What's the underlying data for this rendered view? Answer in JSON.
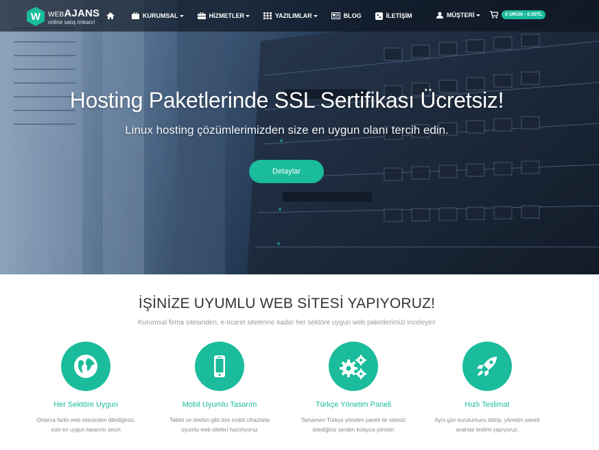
{
  "brand": {
    "logo_letter": "W",
    "name_prefix": "WEB",
    "name_main": "AJANS",
    "tagline": "online satış imkanı!"
  },
  "nav": {
    "home_icon": "home-icon",
    "items": [
      {
        "label": "KURUMSAL",
        "icon": "briefcase-icon",
        "dropdown": true
      },
      {
        "label": "HİZMETLER",
        "icon": "toolbox-icon",
        "dropdown": true
      },
      {
        "label": "YAZILIMLAR",
        "icon": "grid-icon",
        "dropdown": true
      },
      {
        "label": "BLOG",
        "icon": "newspaper-icon",
        "dropdown": false
      },
      {
        "label": "İLETİŞİM",
        "icon": "phone-icon",
        "dropdown": false
      }
    ],
    "account_label": "MÜŞTERİ",
    "cart_label": "0 ÜRÜN - 0.00TL"
  },
  "hero": {
    "title": "Hosting Paketlerinde SSL Sertifikası Ücretsiz!",
    "subtitle": "Linux hosting çözümlerimizden size en uygun olanı tercih edin.",
    "button_label": "Detaylar"
  },
  "features_section": {
    "title": "İŞİNİZE UYUMLU WEB SİTESİ YAPIYORUZ!",
    "subtitle": "Kurumsal firma sitesinden, e-ticaret sitelerine kadar her sektöre uygun web paketlerimizi inceleyin!",
    "items": [
      {
        "icon": "globe-icon",
        "title": "Her Sektöre Uygun",
        "desc_line1": "Onlarca farklı web sitesinden dilediğinizi,",
        "desc_line2": "size en uygun tasarımı seçin"
      },
      {
        "icon": "mobile-phone-icon",
        "title": "Mobil Uyumlu Tasarım",
        "desc_line1": "Tablet ve telefon gibi tüm mobil cihazlarla",
        "desc_line2": "uyumlu web siteleri hazırlıyoruz"
      },
      {
        "icon": "gears-icon",
        "title": "Türkçe Yönetim Paneli",
        "desc_line1": "Tamamen Türkçe yönetim paneli ile sitenizi",
        "desc_line2": "istediğiniz yerden kolayca yönetin"
      },
      {
        "icon": "rocket-icon",
        "title": "Hızlı Teslimat",
        "desc_line1": "Aynı gün kurulumunu bitirip, yönetim paneli",
        "desc_line2": "anahtar teslimi yapıyoruz."
      }
    ]
  },
  "colors": {
    "accent": "#1abc9c",
    "navbar_bg": "#0a101a",
    "text_dark": "#333333",
    "text_muted": "#888888"
  }
}
